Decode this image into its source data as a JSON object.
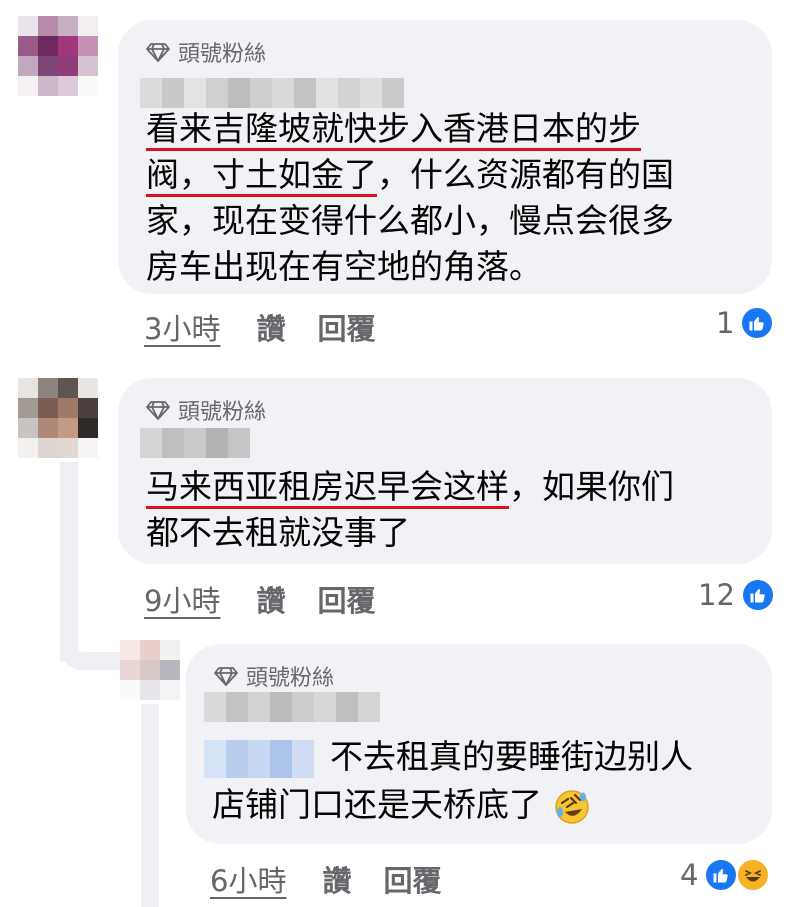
{
  "comments": [
    {
      "badge": "頭號粉絲",
      "text_lines": [
        {
          "underlined": "看来吉隆坡就快步入香港日本的步",
          "rest": ""
        },
        {
          "underlined": "阀，寸土如金了",
          "rest": "，什么资源都有的国"
        },
        {
          "underlined": "",
          "rest": "家，现在变得什么都小，慢点会很多"
        },
        {
          "underlined": "",
          "rest": "房车出现在有空地的角落。"
        }
      ],
      "time": "3小時",
      "like_label": "讚",
      "reply_label": "回覆",
      "reaction_count": "1"
    },
    {
      "badge": "頭號粉絲",
      "text_lines": [
        {
          "underlined": "马来西亚租房迟早会这样",
          "rest": "，如果你们"
        },
        {
          "underlined": "",
          "rest": "都不去租就没事了"
        }
      ],
      "time": "9小時",
      "like_label": "讚",
      "reply_label": "回覆",
      "reaction_count": "12"
    },
    {
      "badge": "頭號粉絲",
      "text_lines": [
        {
          "underlined": "",
          "rest": "不去租真的要睡街边别人"
        },
        {
          "underlined": "",
          "rest": "店铺门口还是天桥底了"
        }
      ],
      "emoji": "rolling-on-floor-laughing",
      "time": "6小時",
      "like_label": "讚",
      "reply_label": "回覆",
      "reaction_count": "4"
    }
  ],
  "icons": {
    "badge": "diamond-icon",
    "reaction_like": "like-reaction-icon",
    "reaction_haha": "haha-reaction-icon"
  },
  "colors": {
    "bubble": "#f0f2f5",
    "like_blue": "#1877f2",
    "underline_red": "#e0101e",
    "meta_gray": "#65676b"
  }
}
